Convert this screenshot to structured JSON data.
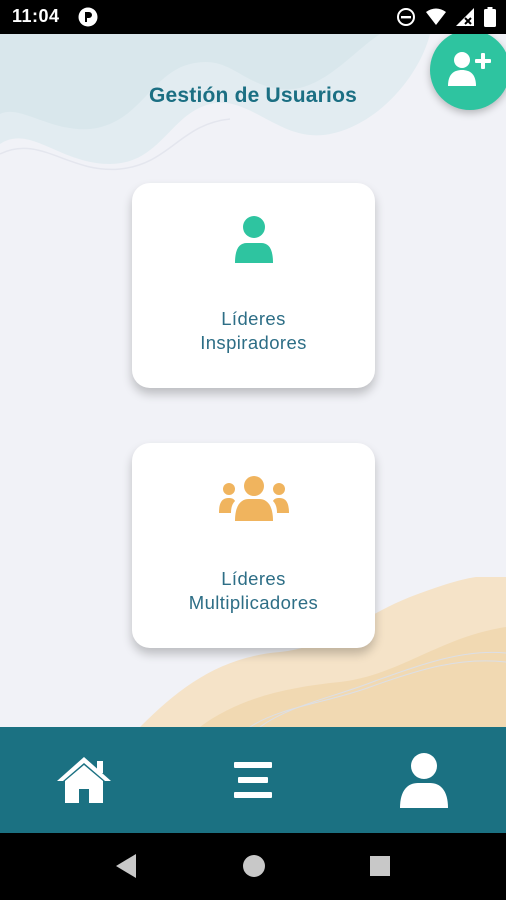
{
  "status_bar": {
    "time": "11:04",
    "icons": [
      "app-notification-icon",
      "do-not-disturb-icon",
      "wifi-icon",
      "no-signal-icon",
      "battery-icon"
    ]
  },
  "header": {
    "title": "Gestión de Usuarios",
    "add_user_icon": "add-user-icon"
  },
  "cards": [
    {
      "label_line1": "Líderes",
      "label_line2": "Inspiradores",
      "icon": "user-icon",
      "icon_color": "#2ec4a0"
    },
    {
      "label_line1": "Líderes",
      "label_line2": "Multiplicadores",
      "icon": "users-group-icon",
      "icon_color": "#f0b45e"
    }
  ],
  "bottom_nav": {
    "items": [
      {
        "name": "home",
        "icon": "home-icon"
      },
      {
        "name": "menu",
        "icon": "menu-icon"
      },
      {
        "name": "profile",
        "icon": "profile-icon"
      }
    ]
  },
  "android_nav": [
    "back-icon",
    "home-circle-icon",
    "recents-icon"
  ],
  "colors": {
    "accent_teal": "#1b7182",
    "fab_green": "#2ec4a0",
    "title_color": "#1b6f83",
    "orange": "#f0b45e"
  }
}
